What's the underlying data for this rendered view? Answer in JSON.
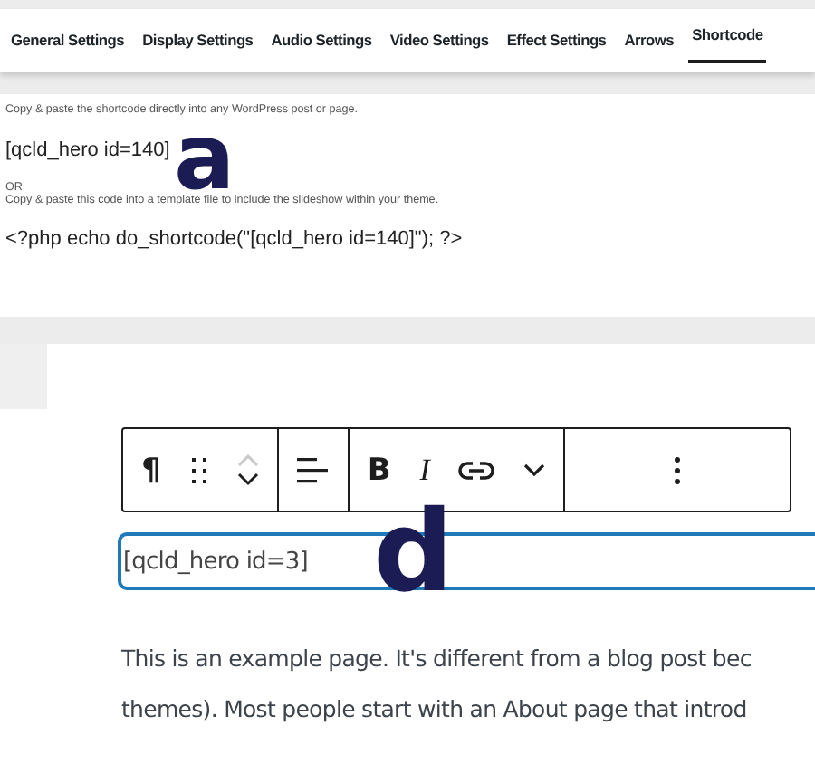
{
  "tabs": [
    {
      "label": "General Settings",
      "selected": false
    },
    {
      "label": "Display Settings",
      "selected": false
    },
    {
      "label": "Audio Settings",
      "selected": false
    },
    {
      "label": "Video Settings",
      "selected": false
    },
    {
      "label": "Effect Settings",
      "selected": false
    },
    {
      "label": "Arrows",
      "selected": false
    },
    {
      "label": "Shortcode",
      "selected": true
    }
  ],
  "shortcode_panel": {
    "intro": "Copy & paste the shortcode directly into any WordPress post or page.",
    "shortcode": "[qcld_hero id=140]",
    "callout": "a",
    "or": "OR",
    "template_note": "Copy & paste this code into a template file to include the slideshow within your theme.",
    "php_code": "<?php echo do_shortcode(\"[qcld_hero id=140]\"); ?>"
  },
  "editor": {
    "toolbar": [
      [
        {
          "kind": "glyph",
          "label": "¶"
        },
        {
          "kind": "drag"
        },
        {
          "kind": "movers",
          "up_disabled": true
        }
      ],
      [
        {
          "kind": "align"
        }
      ],
      [
        {
          "kind": "glyph",
          "label": "B"
        },
        {
          "kind": "glyph_italic",
          "label": "I"
        },
        {
          "kind": "link"
        },
        {
          "kind": "chevron"
        }
      ],
      [
        {
          "kind": "more"
        }
      ]
    ],
    "block_value": "[qcld_hero id=3]",
    "callout": "d",
    "paragraph_lines": [
      "This is an example page. It's different from a blog post bec",
      "themes). Most people start with an About page that introd"
    ]
  }
}
